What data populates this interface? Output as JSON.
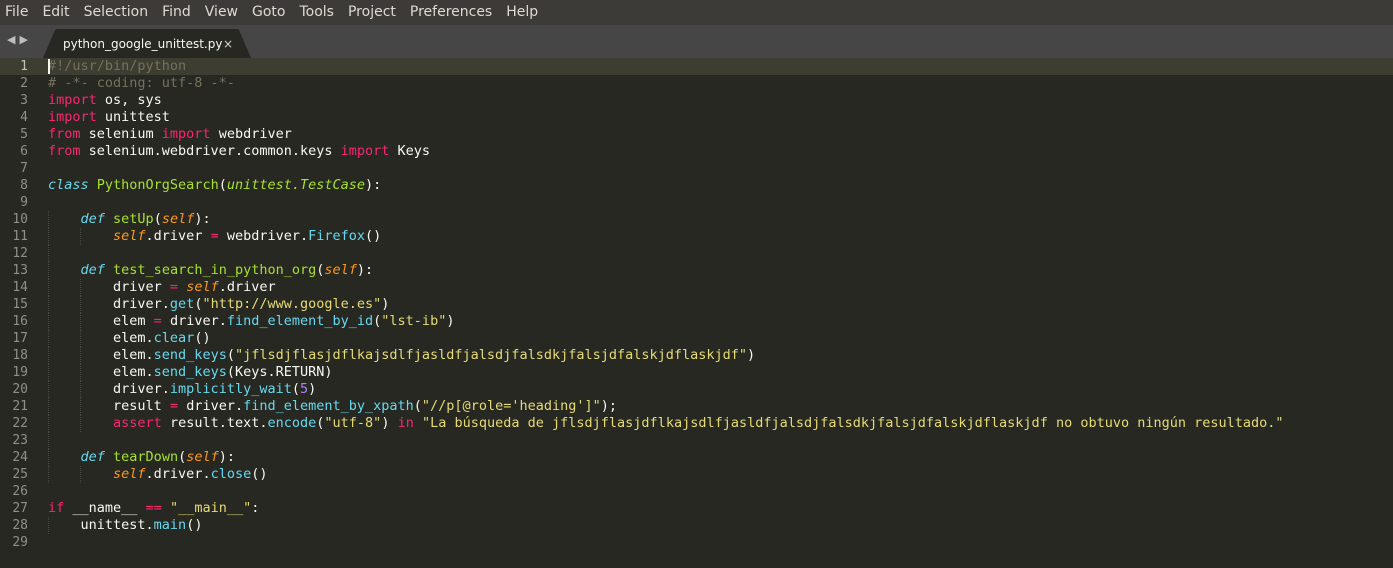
{
  "menu": [
    "File",
    "Edit",
    "Selection",
    "Find",
    "View",
    "Goto",
    "Tools",
    "Project",
    "Preferences",
    "Help"
  ],
  "tabs": {
    "nav_back": "◀",
    "nav_forward": "▶",
    "active_tab": "python_google_unittest.py",
    "close_glyph": "×"
  },
  "editor": {
    "active_line": 1,
    "line_count": 29,
    "theme_colors": {
      "background": "#272822",
      "keyword": "#f92672",
      "function": "#a6e22e",
      "string": "#e6db74",
      "comment": "#75715e",
      "storage": "#66d9ef",
      "parameter": "#fd971f",
      "number": "#ae81ff"
    },
    "lines": [
      [
        [
          "cm",
          "#!/usr/bin/python"
        ]
      ],
      [
        [
          "cm",
          "# -*- coding: utf-8 -*-"
        ]
      ],
      [
        [
          "kw",
          "import"
        ],
        [
          "",
          " os, sys"
        ]
      ],
      [
        [
          "kw",
          "import"
        ],
        [
          "",
          " unittest"
        ]
      ],
      [
        [
          "kw",
          "from"
        ],
        [
          "",
          " selenium "
        ],
        [
          "kw",
          "import"
        ],
        [
          "",
          " webdriver"
        ]
      ],
      [
        [
          "kw",
          "from"
        ],
        [
          "",
          " selenium.webdriver.common.keys "
        ],
        [
          "kw",
          "import"
        ],
        [
          "",
          " Keys"
        ]
      ],
      [],
      [
        [
          "st",
          "class"
        ],
        [
          "",
          " "
        ],
        [
          "cl",
          "PythonOrgSearch"
        ],
        [
          "",
          "("
        ],
        [
          "sup",
          "unittest.TestCase"
        ],
        [
          "",
          "):"
        ]
      ],
      [],
      [
        [
          "",
          "    "
        ],
        [
          "st",
          "def"
        ],
        [
          "",
          " "
        ],
        [
          "fn",
          "setUp"
        ],
        [
          "",
          "("
        ],
        [
          "arg",
          "self"
        ],
        [
          "",
          "):"
        ]
      ],
      [
        [
          "",
          "        "
        ],
        [
          "self",
          "self"
        ],
        [
          "",
          ".driver "
        ],
        [
          "op",
          "="
        ],
        [
          "",
          " webdriver."
        ],
        [
          "bi",
          "Firefox"
        ],
        [
          "",
          "()"
        ]
      ],
      [],
      [
        [
          "",
          "    "
        ],
        [
          "st",
          "def"
        ],
        [
          "",
          " "
        ],
        [
          "fn",
          "test_search_in_python_org"
        ],
        [
          "",
          "("
        ],
        [
          "arg",
          "self"
        ],
        [
          "",
          "):"
        ]
      ],
      [
        [
          "",
          "        driver "
        ],
        [
          "op",
          "="
        ],
        [
          "",
          " "
        ],
        [
          "self",
          "self"
        ],
        [
          "",
          ".driver"
        ]
      ],
      [
        [
          "",
          "        driver."
        ],
        [
          "bi",
          "get"
        ],
        [
          "",
          "("
        ],
        [
          "str",
          "\"http://www.google.es\""
        ],
        [
          "",
          ")"
        ]
      ],
      [
        [
          "",
          "        elem "
        ],
        [
          "op",
          "="
        ],
        [
          "",
          " driver."
        ],
        [
          "bi",
          "find_element_by_id"
        ],
        [
          "",
          "("
        ],
        [
          "str",
          "\"lst-ib\""
        ],
        [
          "",
          ")"
        ]
      ],
      [
        [
          "",
          "        elem."
        ],
        [
          "bi",
          "clear"
        ],
        [
          "",
          "()"
        ]
      ],
      [
        [
          "",
          "        elem."
        ],
        [
          "bi",
          "send_keys"
        ],
        [
          "",
          "("
        ],
        [
          "str",
          "\"jflsdjflasjdflkajsdlfjasldfjalsdjfalsdkjfalsjdfalskjdflaskjdf\""
        ],
        [
          "",
          ")"
        ]
      ],
      [
        [
          "",
          "        elem."
        ],
        [
          "bi",
          "send_keys"
        ],
        [
          "",
          "(Keys.RETURN)"
        ]
      ],
      [
        [
          "",
          "        driver."
        ],
        [
          "bi",
          "implicitly_wait"
        ],
        [
          "",
          "("
        ],
        [
          "num",
          "5"
        ],
        [
          "",
          ")"
        ]
      ],
      [
        [
          "",
          "        result "
        ],
        [
          "op",
          "="
        ],
        [
          "",
          " driver."
        ],
        [
          "bi",
          "find_element_by_xpath"
        ],
        [
          "",
          "("
        ],
        [
          "str",
          "\"//p[@role='heading']\""
        ],
        [
          "",
          ");"
        ]
      ],
      [
        [
          "",
          "        "
        ],
        [
          "kw",
          "assert"
        ],
        [
          "",
          " result.text."
        ],
        [
          "bi",
          "encode"
        ],
        [
          "",
          "("
        ],
        [
          "str",
          "\"utf-8\""
        ],
        [
          "",
          ") "
        ],
        [
          "kw",
          "in"
        ],
        [
          "",
          " "
        ],
        [
          "str",
          "\"La búsqueda de jflsdjflasjdflkajsdlfjasldfjalsdjfalsdkjfalsjdfalskjdflaskjdf no obtuvo ningún resultado.\""
        ]
      ],
      [],
      [
        [
          "",
          "    "
        ],
        [
          "st",
          "def"
        ],
        [
          "",
          " "
        ],
        [
          "fn",
          "tearDown"
        ],
        [
          "",
          "("
        ],
        [
          "arg",
          "self"
        ],
        [
          "",
          "):"
        ]
      ],
      [
        [
          "",
          "        "
        ],
        [
          "self",
          "self"
        ],
        [
          "",
          ".driver."
        ],
        [
          "bi",
          "close"
        ],
        [
          "",
          "()"
        ]
      ],
      [],
      [
        [
          "kw",
          "if"
        ],
        [
          "",
          " __name__ "
        ],
        [
          "op",
          "=="
        ],
        [
          "",
          " "
        ],
        [
          "str",
          "\"__main__\""
        ],
        [
          "",
          ":"
        ]
      ],
      [
        [
          "",
          "    unittest."
        ],
        [
          "bi",
          "main"
        ],
        [
          "",
          "()"
        ]
      ],
      []
    ]
  }
}
